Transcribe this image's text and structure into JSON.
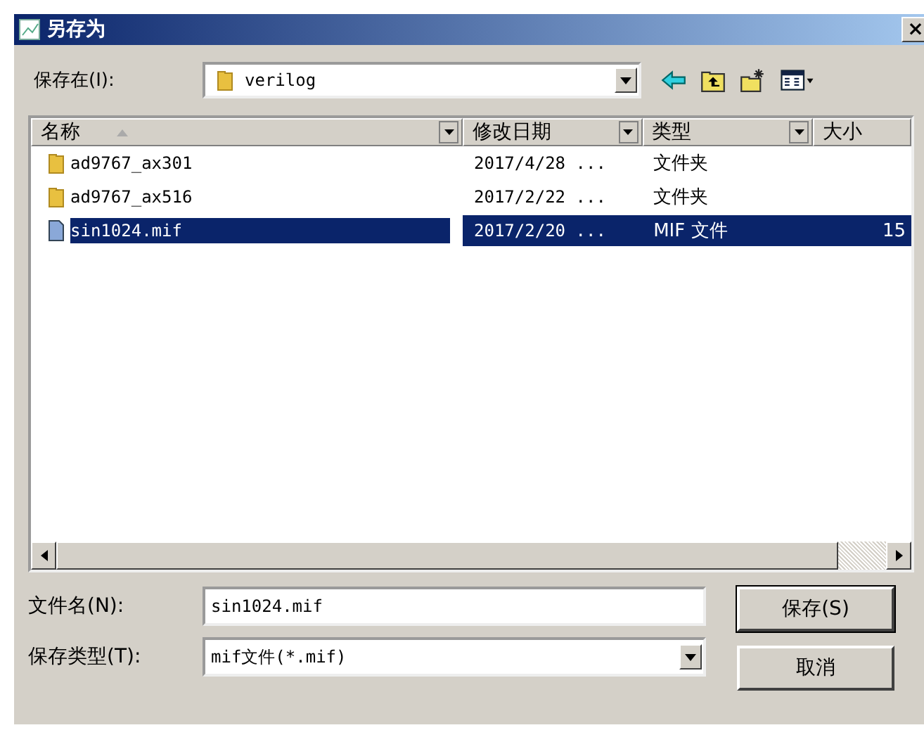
{
  "window": {
    "title": "另存为",
    "close": "×"
  },
  "save_in": {
    "label": "保存在(I):",
    "value": "verilog"
  },
  "columns": [
    {
      "label": "名称",
      "sorted": true
    },
    {
      "label": "修改日期",
      "sorted": false
    },
    {
      "label": "类型",
      "sorted": false
    },
    {
      "label": "大小",
      "sorted": false
    }
  ],
  "rows": [
    {
      "kind": "folder",
      "name": "ad9767_ax301",
      "date": "2017/4/28 ...",
      "type": "文件夹",
      "selected": false
    },
    {
      "kind": "folder",
      "name": "ad9767_ax516",
      "date": "2017/2/22 ...",
      "type": "文件夹",
      "selected": false
    },
    {
      "kind": "file",
      "name": "sin1024.mif",
      "date": "2017/2/20 ...",
      "type": "MIF 文件",
      "size": "15",
      "selected": true
    }
  ],
  "file_name": {
    "label": "文件名(N):",
    "value": "sin1024.mif"
  },
  "file_type": {
    "label": "保存类型(T):",
    "value": "mif文件(*.mif)"
  },
  "buttons": [
    "保存(S)",
    "取消"
  ]
}
